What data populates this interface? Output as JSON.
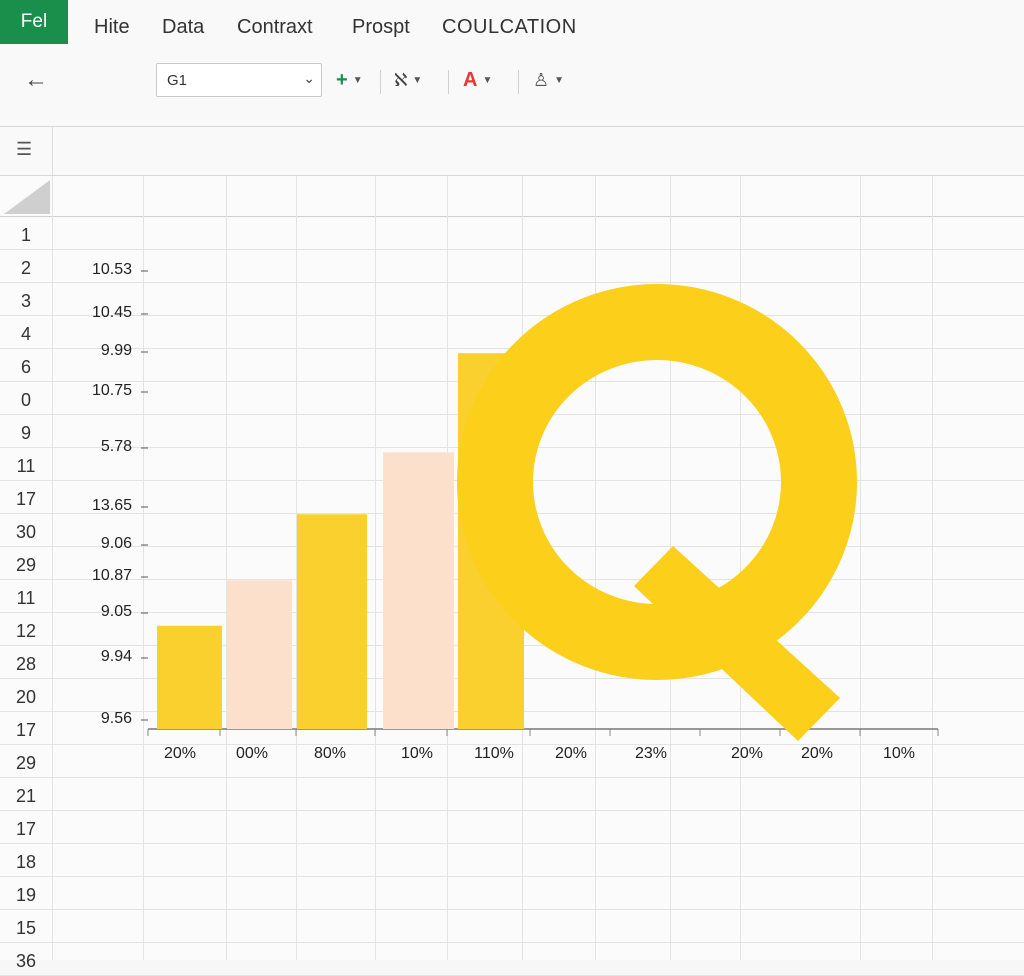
{
  "menubar": {
    "file_label": "Fel",
    "items": [
      "Hite",
      "Data",
      "Contraxt",
      "Prospt",
      "COULCATION"
    ]
  },
  "toolbar": {
    "name_box_value": "G1"
  },
  "row_labels": [
    "1",
    "2",
    "3",
    "4",
    "6",
    "0",
    "9",
    "11",
    "17",
    "30",
    "29",
    "11",
    "12",
    "28",
    "20",
    "17",
    "29",
    "21",
    "17",
    "18",
    "19",
    "15",
    "36"
  ],
  "colors": {
    "file_tab": "#1a8f4c",
    "bar_yellow": "#f9d02e",
    "bar_peach": "#fde0cb",
    "overlay_q": "#fbcf1a",
    "font_color_icon": "#e53935"
  },
  "overlay": {
    "letter": "Q"
  },
  "chart_data": {
    "type": "bar",
    "y_tick_labels": [
      "10.53",
      "10.45",
      "9.99",
      "10.75",
      "5.78",
      "13.65",
      "9.06",
      "10.87",
      "9.05",
      "9.94",
      "9.56"
    ],
    "x_tick_labels": [
      "20%",
      "00%",
      "80%",
      "10%",
      "110%",
      "20%",
      "23%",
      "20%",
      "20%",
      "10%"
    ],
    "bars": [
      {
        "category": "20%",
        "level": 0.25,
        "color": "yellow"
      },
      {
        "category": "00%",
        "level": 0.36,
        "color": "peach"
      },
      {
        "category": "80%",
        "level": 0.52,
        "color": "yellow"
      },
      {
        "category": "10%",
        "level": 0.67,
        "color": "peach"
      },
      {
        "category": "110%",
        "level": 0.91,
        "color": "yellow"
      }
    ]
  }
}
